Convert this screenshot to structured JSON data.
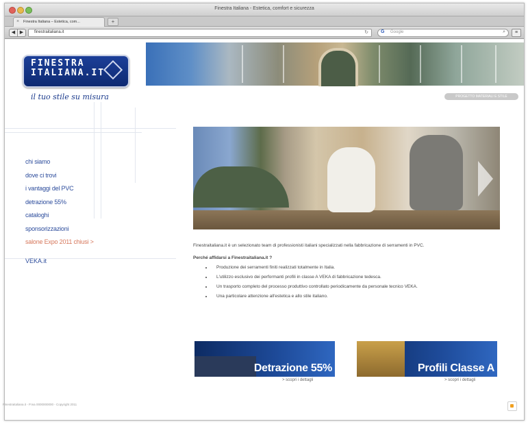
{
  "window": {
    "title": "Finestra Italiana - Estetica, comfort e sicurezza"
  },
  "tab": {
    "label": "Finestra Italiana – Estetica, com..."
  },
  "toolbar": {
    "url": "finestraitaliana.it",
    "search_placeholder": "Google",
    "search_engine": "G"
  },
  "site": {
    "logo_line1": "FINESTRA",
    "logo_line2": "ITALIANA.IT",
    "slogan": "il tuo stile su misura",
    "topright_button": "PROGETTO MATERIALI E STILE"
  },
  "sidebar": {
    "items": [
      {
        "label": "chi siamo",
        "alt": false
      },
      {
        "label": "dove ci trovi",
        "alt": false
      },
      {
        "label": "i vantaggi del PVC",
        "alt": false
      },
      {
        "label": "detrazione 55%",
        "alt": false
      },
      {
        "label": "cataloghi",
        "alt": false
      },
      {
        "label": "sponsorizzazioni",
        "alt": false
      },
      {
        "label": "salone Expo 2011 chiusi >",
        "alt": true
      }
    ],
    "veka_label": "VEKA.it"
  },
  "main": {
    "intro": "Finestraitaliana.it è un selezionato team di professionisti italiani specializzati nella fabbricazione di serramenti in PVC.",
    "why_heading": "Perché affidarsi a Finestraitaliana.it ?",
    "points": [
      "Produzione dei serramenti finiti realizzati totalmente in Italia.",
      "L'utilizzo esclusivo dei performanti profili in classe A VEKA di fabbricazione tedesca.",
      "Un trasporto completo del processo produttivo controllato periodicamente da personale tecnico VEKA.",
      "Una particolare attenzione all'estetica e allo stile italiano."
    ]
  },
  "promos": [
    {
      "label": "Detrazione 55%",
      "link": "> scopri i dettagli"
    },
    {
      "label": "Profili Classe A",
      "link": "> scopri i dettagli"
    }
  ],
  "footer": {
    "text": "Finestraitaliana.it - P.Iva 0000000000 - Copyright 2011"
  }
}
